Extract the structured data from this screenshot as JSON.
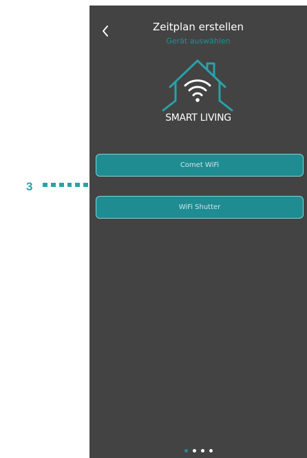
{
  "header": {
    "title": "Zeitplan erstellen",
    "subtitle": "Gerät auswählen"
  },
  "logo": {
    "text": "SMART LIVING",
    "icon": "house-wifi-icon"
  },
  "devices": [
    {
      "label": "Comet WiFi"
    },
    {
      "label": "WiFi Shutter"
    }
  ],
  "callout": {
    "number": "3"
  },
  "pager": {
    "count": 4,
    "active_index": 0
  },
  "colors": {
    "background": "#434343",
    "accent": "#1f8f98",
    "button": "#1f8c91",
    "callout": "#2aa1a9"
  }
}
